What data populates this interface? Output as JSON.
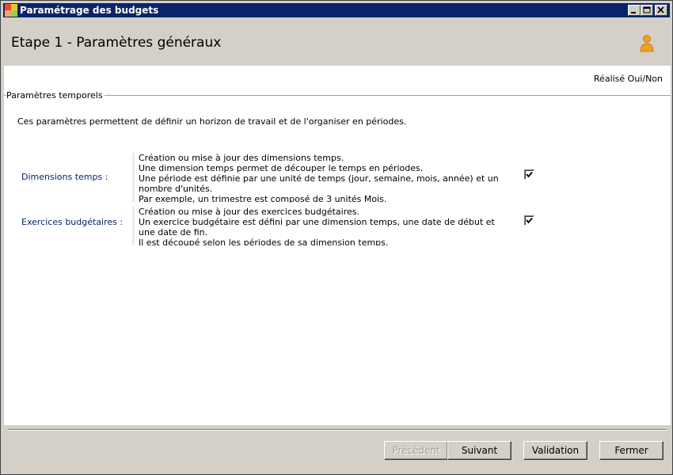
{
  "window": {
    "title": "Paramétrage des budgets"
  },
  "header": {
    "title": "Etape 1 - Paramètres généraux"
  },
  "content": {
    "realise_label": "Réalisé Oui/Non",
    "group_label": "Paramètres temporels",
    "intro": "Ces paramètres permettent de définir un horizon de travail et de l'organiser en périodes.",
    "rows": [
      {
        "label": "Dimensions temps :",
        "lines": [
          "Création ou mise à jour des dimensions temps.",
          "Une dimension temps permet de découper le temps en périodes.",
          "Une période est définie par une unité de temps (jour, semaine, mois, année) et un nombre d'unités.",
          "Par exemple, un trimestre est composé de 3 unités Mois."
        ],
        "checked": true
      },
      {
        "label": "Exercices budgétaires :",
        "lines": [
          "Création ou mise à jour des exercices budgétaires.",
          "Un exercice budgétaire est défini par une dimension temps, une date de début et une date de fin.",
          "Il est découpé selon les périodes de sa dimension temps."
        ],
        "checked": true
      }
    ]
  },
  "buttons": {
    "previous": "Précédent",
    "next": "Suivant",
    "validation": "Validation",
    "close": "Fermer"
  },
  "colors": {
    "titlebar": "#0a246a",
    "face": "#d4d0c8",
    "label_blue": "#0a246a",
    "user_icon": "#f0a020"
  }
}
